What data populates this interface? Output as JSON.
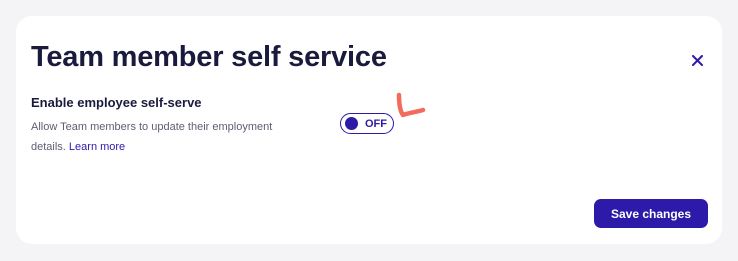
{
  "modal": {
    "title": "Team member self service",
    "close_icon": "close-icon"
  },
  "setting": {
    "label": "Enable employee self-serve",
    "description": "Allow Team members to update their employment details.",
    "learn_more": "Learn more",
    "toggle": {
      "state_label": "OFF",
      "enabled": false
    }
  },
  "footer": {
    "save_label": "Save changes"
  },
  "colors": {
    "accent": "#2e1aa8",
    "title_text": "#1a1a3d",
    "description_text": "#5e5e72",
    "annotation": "#f26b5b",
    "page_background": "#f4f4f7"
  }
}
